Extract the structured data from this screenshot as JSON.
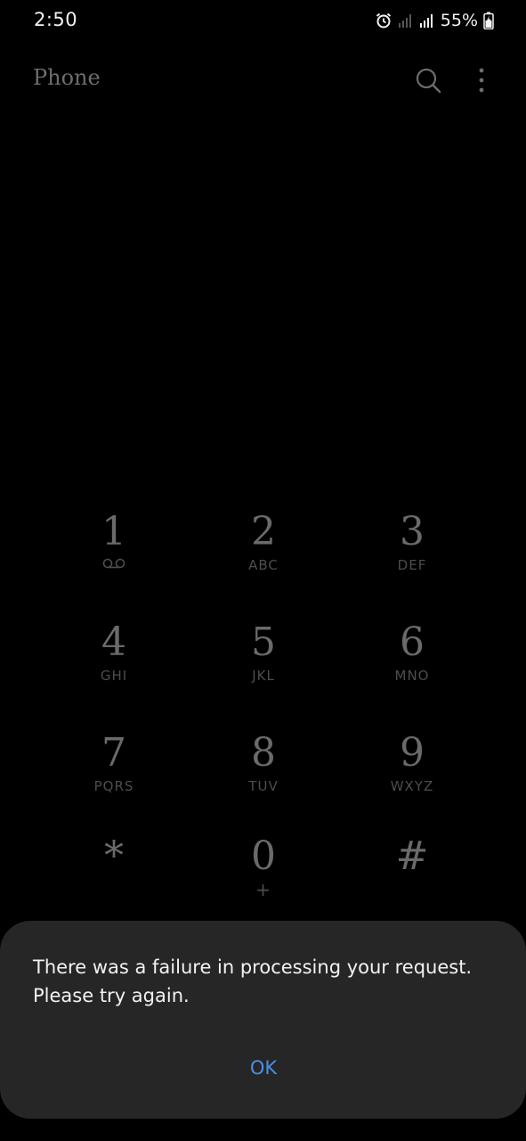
{
  "status_bar": {
    "time": "2:50",
    "battery": "55%",
    "icons": [
      "alarm-icon",
      "signal-icon",
      "signal-icon",
      "battery-charging-icon"
    ]
  },
  "header": {
    "title": "Phone",
    "search_icon": "search-icon",
    "more_icon": "more-vertical-icon"
  },
  "dialpad": {
    "keys": [
      {
        "digit": "1",
        "letters": "",
        "sub_icon": "voicemail-icon"
      },
      {
        "digit": "2",
        "letters": "ABC"
      },
      {
        "digit": "3",
        "letters": "DEF"
      },
      {
        "digit": "4",
        "letters": "GHI"
      },
      {
        "digit": "5",
        "letters": "JKL"
      },
      {
        "digit": "6",
        "letters": "MNO"
      },
      {
        "digit": "7",
        "letters": "PQRS"
      },
      {
        "digit": "8",
        "letters": "TUV"
      },
      {
        "digit": "9",
        "letters": "WXYZ"
      },
      {
        "digit": "*",
        "letters": ""
      },
      {
        "digit": "0",
        "letters": "+"
      },
      {
        "digit": "#",
        "letters": ""
      }
    ]
  },
  "dialog": {
    "message": "There was a failure in processing your request. Please try again.",
    "ok_label": "OK"
  },
  "colors": {
    "background": "#000000",
    "dialog_background": "#262626",
    "accent": "#4a8fe6"
  }
}
